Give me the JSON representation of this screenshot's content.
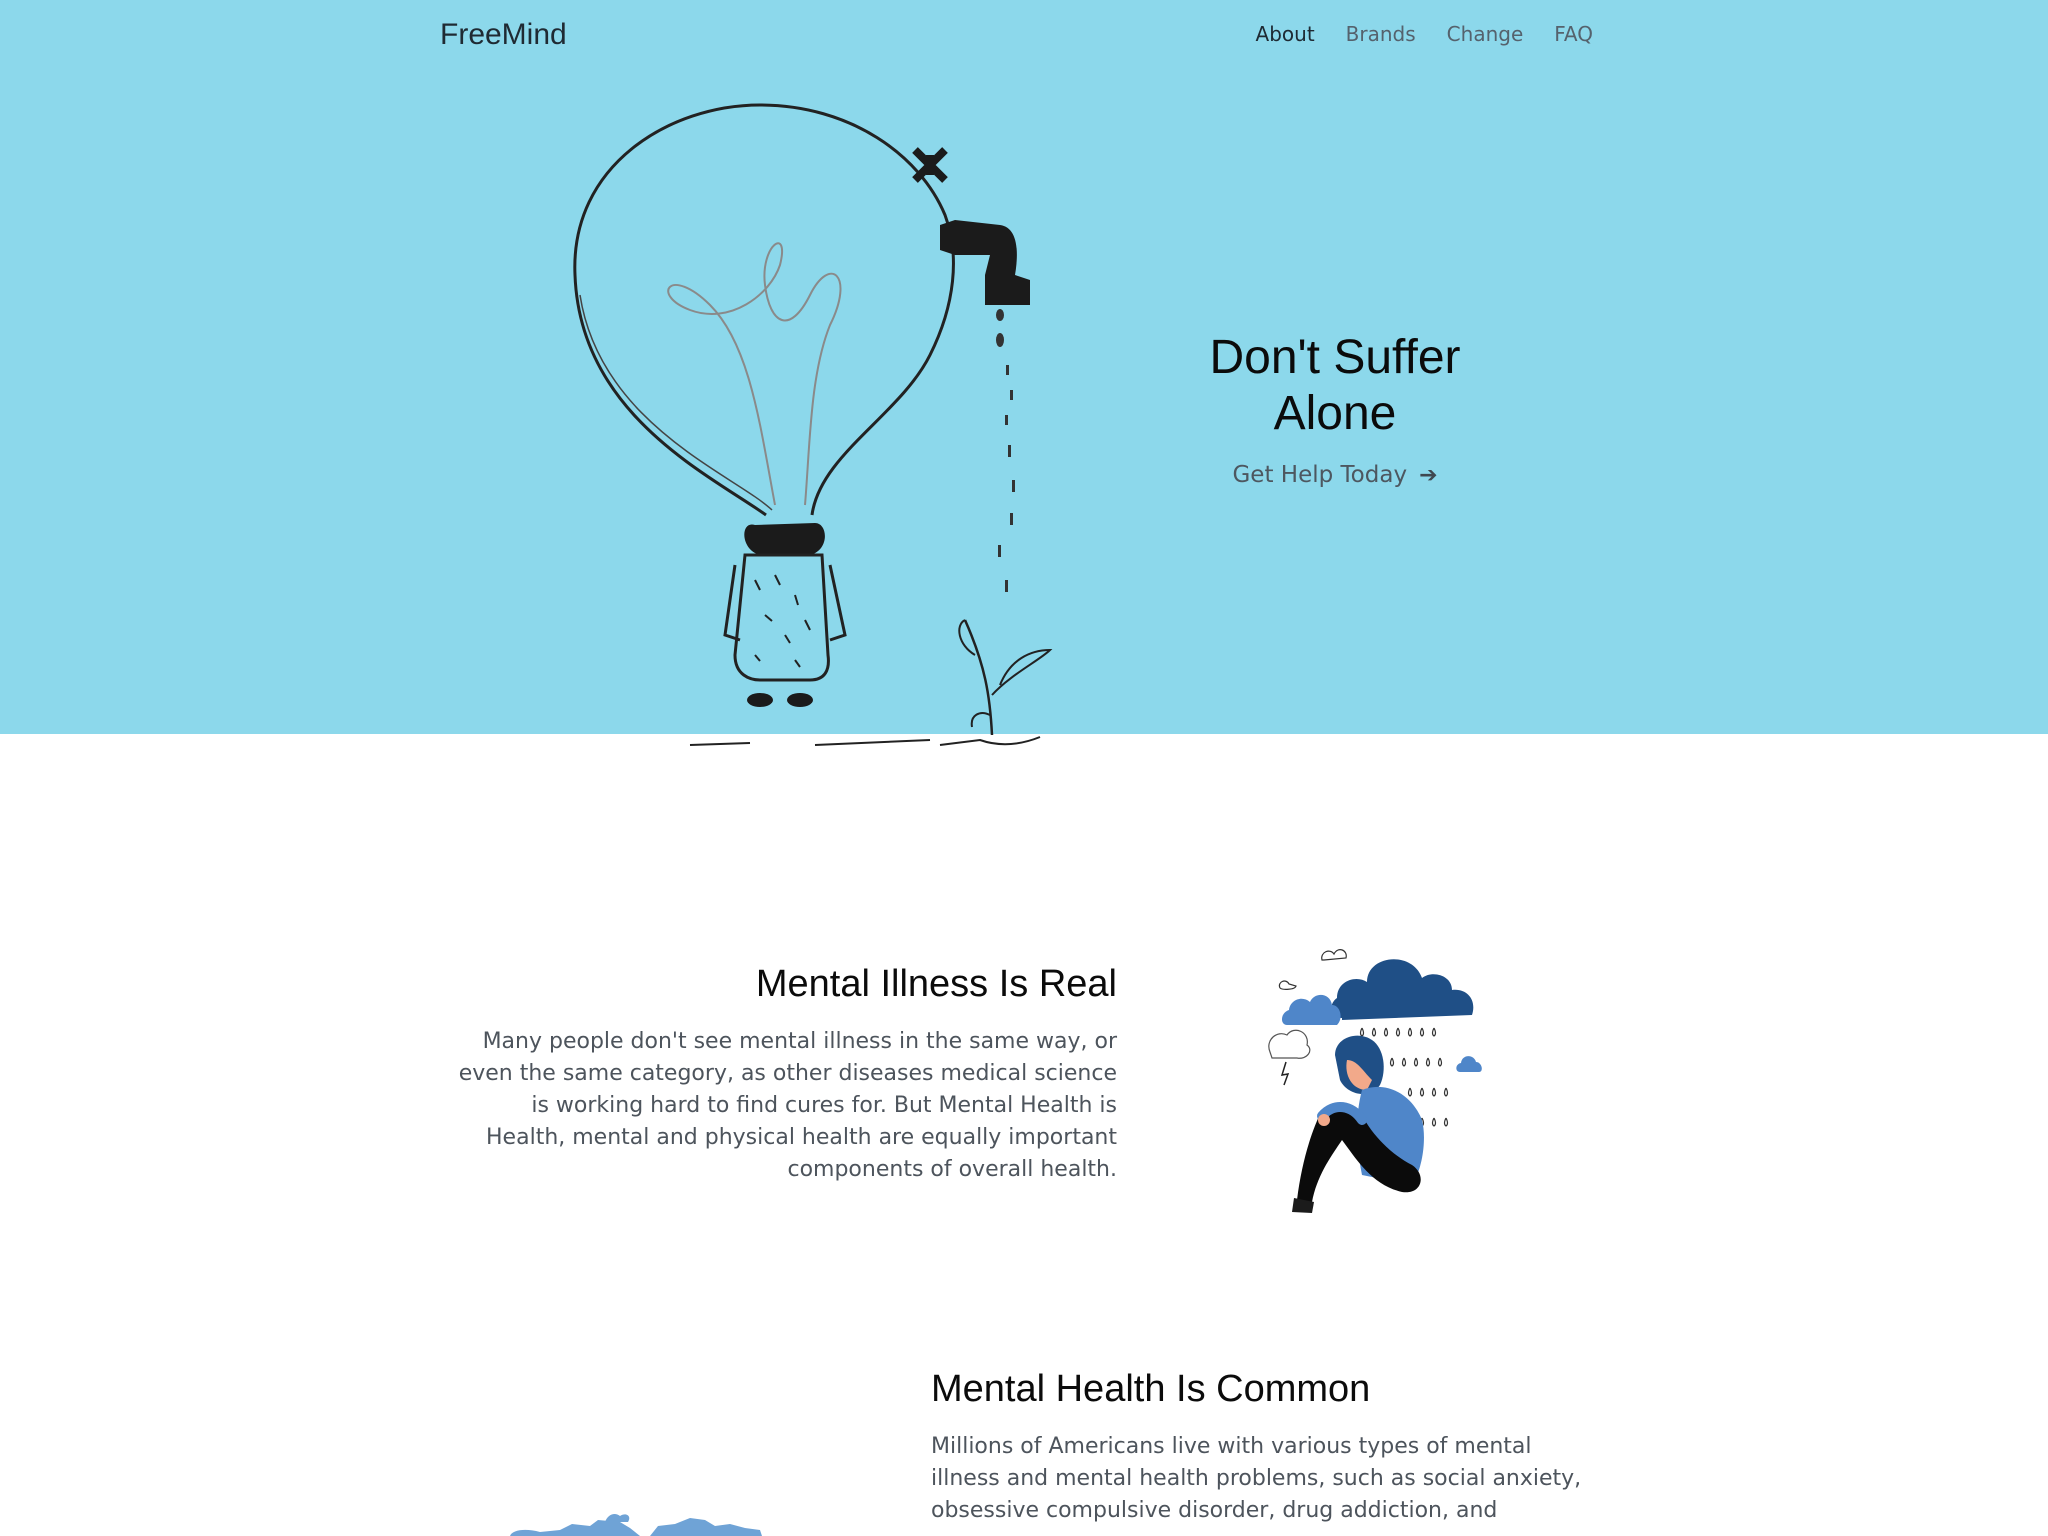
{
  "header": {
    "brand": "FreeMind",
    "nav": [
      {
        "label": "About"
      },
      {
        "label": "Brands"
      },
      {
        "label": "Change"
      },
      {
        "label": "FAQ"
      }
    ]
  },
  "hero": {
    "title_line1": "Don't Suffer",
    "title_line2": "Alone",
    "cta_label": "Get Help Today",
    "cta_icon": "arrow-right-icon",
    "background": "#8cd8eb",
    "illustration": "lightbulb-faucet-plant-illustration"
  },
  "section_real": {
    "title": "Mental Illness Is Real",
    "body": "Many people don't see mental illness in the same way, or even the same category, as other diseases medical science is working hard to find cures for. But Mental Health is Health, mental and physical health are equally important components of overall health.",
    "illustration": "sad-person-rain-cloud-illustration"
  },
  "section_common": {
    "title": "Mental Health Is Common",
    "body": "Millions of Americans live with various types of mental illness and mental health problems, such as social anxiety, obsessive compulsive disorder, drug addiction, and",
    "illustration": "world-map-illustration"
  },
  "colors": {
    "hero_bg": "#8cd8eb",
    "accent_blue": "#4f86c9",
    "dark_blue": "#1f4f86"
  }
}
